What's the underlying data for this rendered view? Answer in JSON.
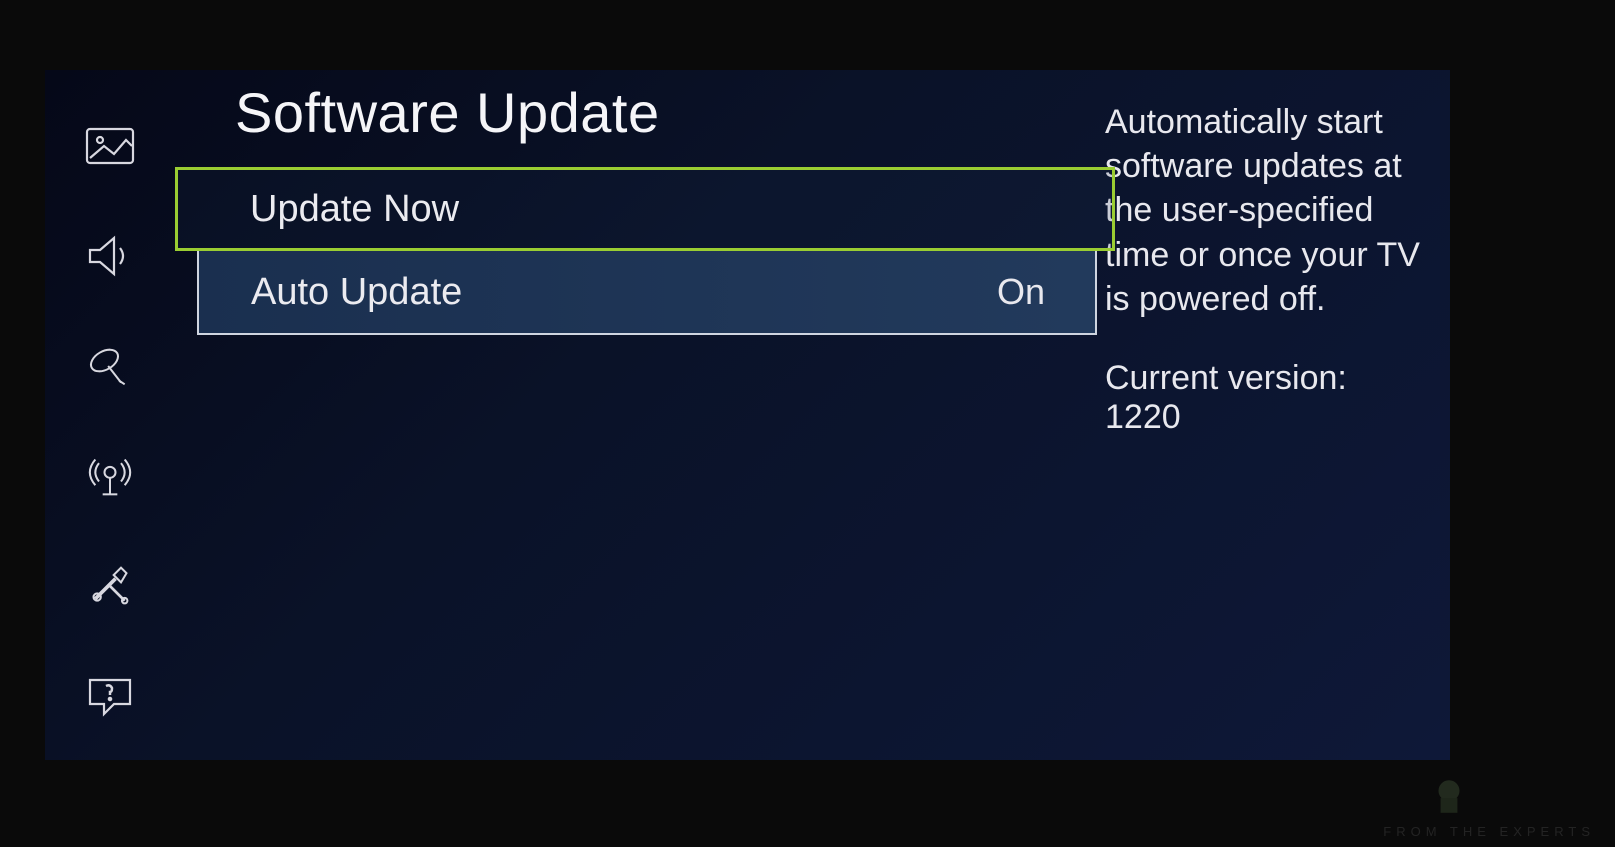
{
  "page": {
    "title": "Software Update"
  },
  "sidebar": {
    "items": [
      {
        "name": "picture-icon"
      },
      {
        "name": "sound-icon"
      },
      {
        "name": "broadcasting-icon"
      },
      {
        "name": "network-icon"
      },
      {
        "name": "system-icon"
      },
      {
        "name": "support-icon"
      }
    ]
  },
  "menu": {
    "items": [
      {
        "label": "Update Now",
        "value": "",
        "highlighted": true
      },
      {
        "label": "Auto Update",
        "value": "On",
        "selected": true
      }
    ]
  },
  "info": {
    "description": "Automatically start software updates at the user-specified time or once your TV is powered off.",
    "version_label": "Current version: 1220"
  },
  "watermark": {
    "text": "FROM THE EXPERTS"
  }
}
